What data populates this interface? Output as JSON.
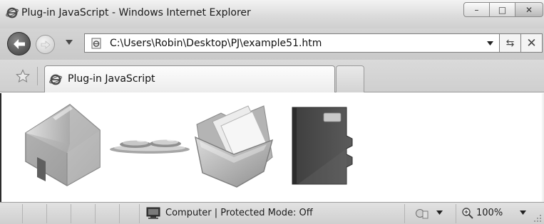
{
  "window": {
    "title": "Plug-in JavaScript - Windows Internet Explorer",
    "minimize_glyph": "–",
    "maximize_glyph": "□",
    "close_glyph": "✕"
  },
  "navigation": {
    "address": "C:\\Users\\Robin\\Desktop\\PJ\\example51.htm",
    "refresh_glyph": "⇆",
    "stop_glyph": "✕"
  },
  "tabs": [
    {
      "label": "Plug-in JavaScript",
      "active": true
    }
  ],
  "content": {
    "plugins": [
      {
        "icon": "house-icon"
      },
      {
        "icon": "dishes-icon"
      },
      {
        "icon": "folder-icon"
      },
      {
        "icon": "notebook-icon"
      }
    ]
  },
  "statusbar": {
    "zone": "Computer | Protected Mode: Off",
    "zoom": "100%"
  },
  "colors": {
    "chrome": "#d4d4d4",
    "accent_dark": "#3b3b3b",
    "content_bg": "#ffffff"
  }
}
